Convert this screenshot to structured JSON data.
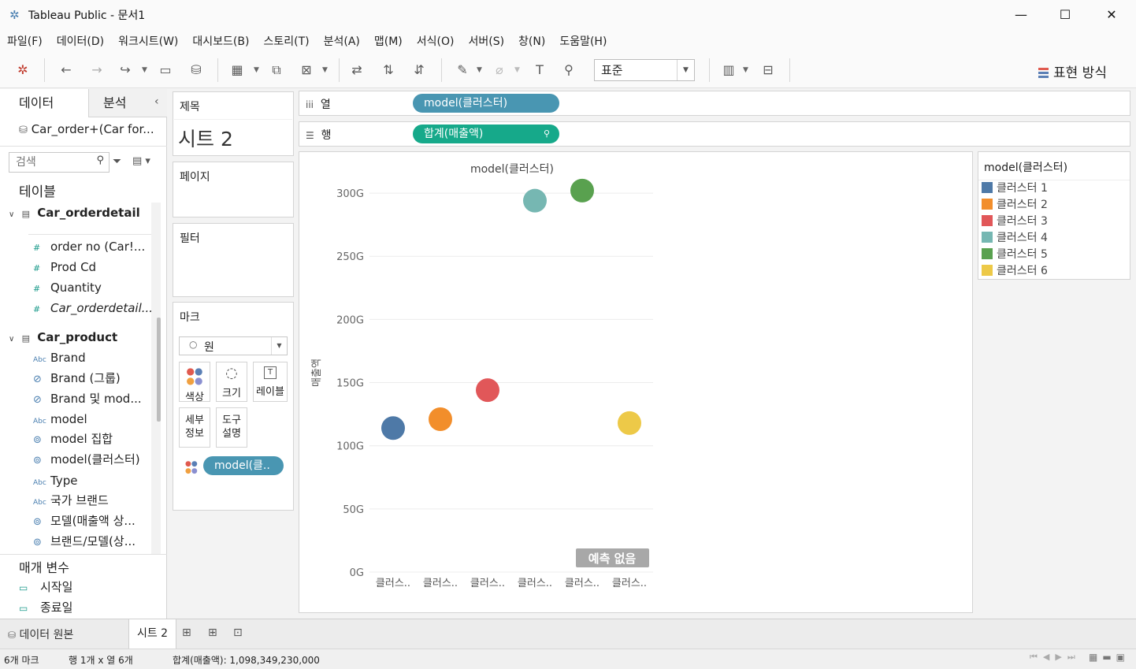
{
  "window": {
    "title": "Tableau Public - 문서1",
    "minimize": "—",
    "maximize": "☐",
    "close": "✕"
  },
  "menu": [
    "파일(F)",
    "데이터(D)",
    "워크시트(W)",
    "대시보드(B)",
    "스토리(T)",
    "분석(A)",
    "맵(M)",
    "서식(O)",
    "서버(S)",
    "창(N)",
    "도움말(H)"
  ],
  "toolbar": {
    "fit_value": "표준",
    "show_me": "표현 방식"
  },
  "data_pane": {
    "tab_data": "데이터",
    "tab_analytics": "분석",
    "datasource": "Car_order+(Car for...",
    "search_placeholder": "검색",
    "tables_heading": "테이블",
    "table1": {
      "name": "Car_orderdetail",
      "fields": [
        {
          "icon": "#",
          "label": "order no (Car!..."
        },
        {
          "icon": "#",
          "label": "Prod Cd"
        },
        {
          "icon": "#",
          "label": "Quantity"
        },
        {
          "icon": "#",
          "label": "Car_orderdetail..."
        }
      ]
    },
    "table2": {
      "name": "Car_product",
      "fields": [
        {
          "icon": "Abc",
          "label": "Brand"
        },
        {
          "icon": "⊘",
          "label": "Brand (그룹)"
        },
        {
          "icon": "⊘",
          "label": "Brand 및 mod..."
        },
        {
          "icon": "Abc",
          "label": "model"
        },
        {
          "icon": "⊚",
          "label": "model 집합"
        },
        {
          "icon": "⊚",
          "label": "model(클러스터)"
        },
        {
          "icon": "Abc",
          "label": "Type"
        },
        {
          "icon": "Abc",
          "label": "국가 브랜드"
        },
        {
          "icon": "⊚",
          "label": "모델(매출액 상..."
        },
        {
          "icon": "⊚",
          "label": "브랜드/모델(상..."
        }
      ]
    },
    "params_heading": "매개 변수",
    "params": [
      "시작일",
      "종료일"
    ]
  },
  "cards": {
    "title_label": "제목",
    "sheet_title": "시트 2",
    "pages_label": "페이지",
    "filters_label": "필터",
    "marks_label": "마크",
    "mark_type": "원",
    "mark_buttons": [
      "색상",
      "크기",
      "레이블"
    ],
    "detail_button": "세부\n정보",
    "tooltip_button": "도구\n설명",
    "color_pill": "model(클.."
  },
  "shelves": {
    "columns_label": "열",
    "columns_pill": "model(클러스터)",
    "rows_label": "행",
    "rows_pill": "합계(매출액)"
  },
  "legend": {
    "title": "model(클러스터)",
    "items": [
      {
        "label": "클러스터 1",
        "color": "#4e79a7"
      },
      {
        "label": "클러스터 2",
        "color": "#f28e2b"
      },
      {
        "label": "클러스터 3",
        "color": "#e15759"
      },
      {
        "label": "클러스터 4",
        "color": "#76b7b2"
      },
      {
        "label": "클러스터 5",
        "color": "#59a14f"
      },
      {
        "label": "클러스터 6",
        "color": "#edc948"
      }
    ]
  },
  "chart_data": {
    "type": "scatter",
    "title": "model(클러스터)",
    "ylabel": "매출액",
    "ylim": [
      0,
      320
    ],
    "y_unit": "G",
    "y_ticks": [
      "0G",
      "50G",
      "100G",
      "150G",
      "200G",
      "250G",
      "300G"
    ],
    "categories": [
      "클러스..",
      "클러스..",
      "클러스..",
      "클러스..",
      "클러스..",
      "클러스.."
    ],
    "values": [
      114,
      121,
      144,
      294,
      302,
      118
    ],
    "colors": [
      "#4e79a7",
      "#f28e2b",
      "#e15759",
      "#76b7b2",
      "#59a14f",
      "#edc948"
    ],
    "annotation": "예측 없음"
  },
  "sheet_tabs": {
    "datasource_tab": "데이터 원본",
    "sheet_tab": "시트 2"
  },
  "status": {
    "marks": "6개 마크",
    "rows_cols": "행 1개 x 열 6개",
    "sum": "합계(매출액): 1,098,349,230,000"
  }
}
